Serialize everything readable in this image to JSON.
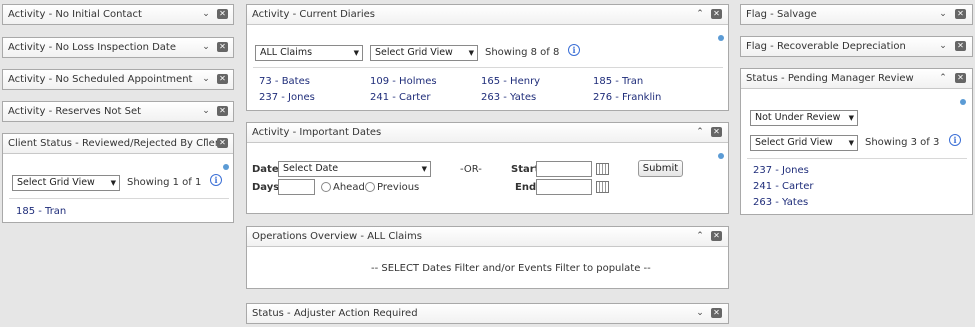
{
  "left_column": {
    "panels": [
      {
        "title": "Activity - No Initial Contact"
      },
      {
        "title": "Activity - No Loss Inspection Date"
      },
      {
        "title": "Activity - No Scheduled Appointment"
      },
      {
        "title": "Activity - Reserves Not Set"
      }
    ],
    "client_status": {
      "title": "Client Status - Reviewed/Rejected By Client",
      "grid_view": "Select Grid View",
      "showing": "Showing  1 of 1",
      "items": [
        "185 - Tran"
      ]
    }
  },
  "current_diaries": {
    "title": "Activity - Current Diaries",
    "filter": "ALL Claims",
    "grid_view": "Select Grid View",
    "showing": "Showing  8 of 8",
    "items": [
      "73 - Bates",
      "109 - Holmes",
      "165 - Henry",
      "185 - Tran",
      "237 - Jones",
      "241 - Carter",
      "263 - Yates",
      "276 - Franklin"
    ]
  },
  "important_dates": {
    "title": "Activity - Important Dates",
    "date_label": "Date:",
    "date_select": "Select Date",
    "or_label": "-OR-",
    "start_label": "Start:",
    "submit": "Submit",
    "days_label": "Days:",
    "ahead": "Ahead",
    "previous": "Previous",
    "end_label": "End:"
  },
  "operations": {
    "title": "Operations Overview - ALL Claims",
    "message": "-- SELECT Dates Filter and/or Events Filter to populate --"
  },
  "adjuster": {
    "title": "Status - Adjuster Action Required"
  },
  "right_column": {
    "panels": [
      {
        "title": "Flag - Salvage"
      },
      {
        "title": "Flag - Recoverable Depreciation"
      }
    ],
    "pending": {
      "title": "Status - Pending Manager Review",
      "review_select": "Not Under Review",
      "grid_view": "Select Grid View",
      "showing": "Showing  3 of 3",
      "items": [
        "237 - Jones",
        "241 - Carter",
        "263 - Yates"
      ]
    }
  },
  "icons": {
    "collapse": "chevron-down-icon",
    "expand": "chevron-up-icon",
    "close": "close-icon",
    "info": "info-icon"
  }
}
